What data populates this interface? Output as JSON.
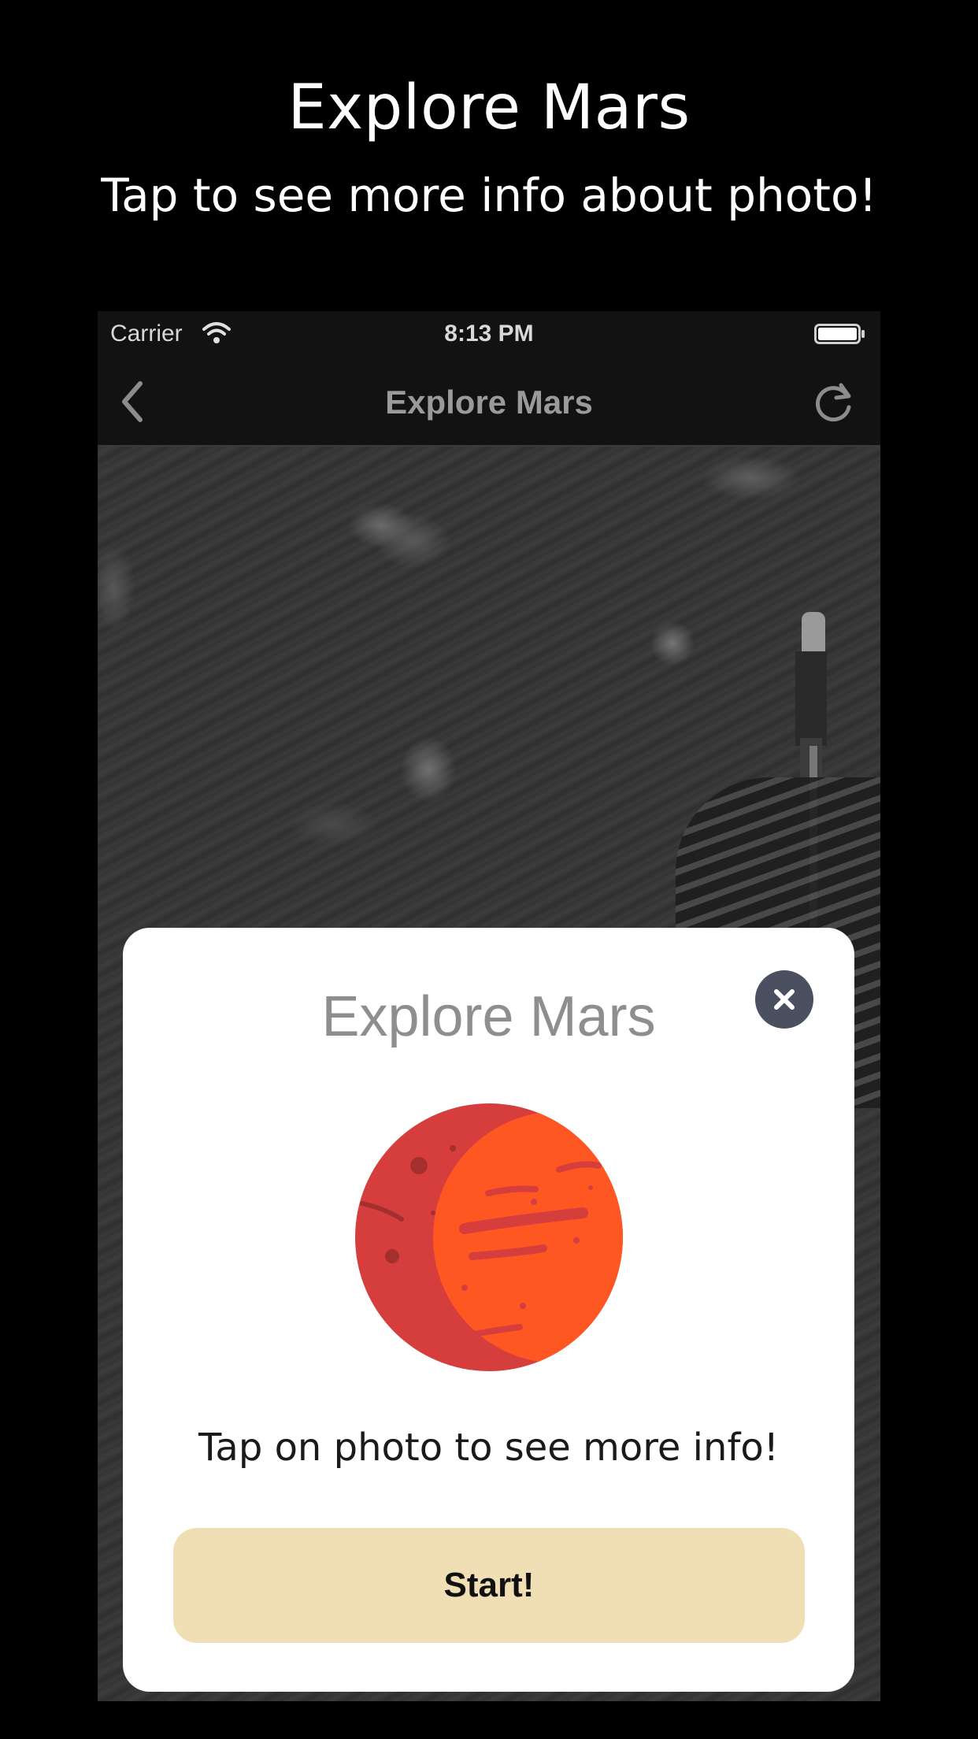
{
  "promo": {
    "title": "Explore Mars",
    "subtitle": "Tap to see more info about photo!"
  },
  "status_bar": {
    "carrier": "Carrier",
    "time": "8:13 PM",
    "icons": [
      "wifi-icon",
      "battery-icon"
    ]
  },
  "nav_bar": {
    "title": "Explore Mars",
    "back_icon": "chevron-left-icon",
    "refresh_icon": "refresh-icon"
  },
  "modal": {
    "title": "Explore Mars",
    "close_icon": "close-icon",
    "illustration": "mars-planet-icon",
    "message": "Tap on photo to see more info!",
    "start_label": "Start!"
  },
  "colors": {
    "background": "#000000",
    "nav_background": "#121212",
    "modal_background": "#ffffff",
    "start_button": "#f0dfb4",
    "close_button": "#4a5060",
    "mars_dark": "#d63e3e",
    "mars_light": "#ff5722"
  }
}
